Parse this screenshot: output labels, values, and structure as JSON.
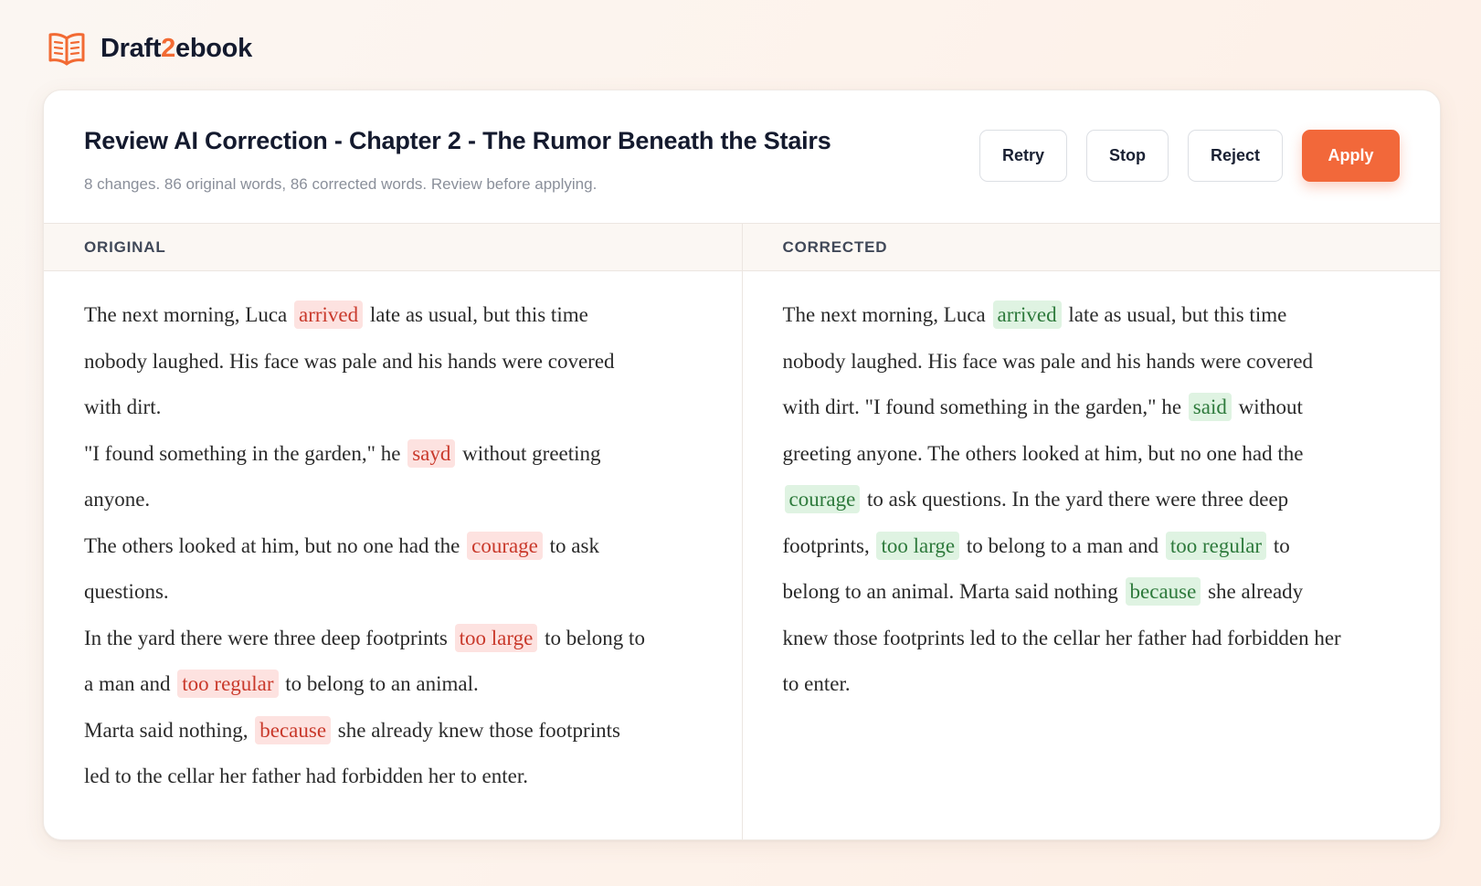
{
  "brand": {
    "name_prefix": "Draft",
    "name_accent": "2",
    "name_suffix": "ebook",
    "icon": "open-book-icon",
    "accent_color": "#f26a33"
  },
  "header": {
    "title": "Review AI Correction - Chapter 2 - The Rumor Beneath the Stairs",
    "subtitle": "8 changes. 86 original words, 86 corrected words. Review before applying."
  },
  "actions": {
    "retry": "Retry",
    "stop": "Stop",
    "reject": "Reject",
    "apply": "Apply",
    "apply_color": "#f2683a"
  },
  "original": {
    "label": "ORIGINAL",
    "highlight_color": "#c9392b",
    "paragraphs": [
      {
        "t1": "The next morning, Luca",
        "h1": "arrived",
        "t2": "late as usual, but this time nobody laughed. His face was pale and his hands were covered with dirt."
      },
      {
        "t1": "\"I found something in the garden,\" he",
        "h1": "sayd",
        "t2": "without greeting anyone."
      },
      {
        "t1": "The others looked at him, but no one had the",
        "h1": "courage",
        "t2": "to ask questions."
      },
      {
        "t1": "In the yard there were three deep footprints",
        "h1": "too large",
        "t2": "to belong to a man and",
        "h2": "too regular",
        "t3": "to belong to an animal."
      },
      {
        "t1": "Marta said nothing,",
        "h1": "because",
        "t2": "she already knew those footprints led to the cellar her father had forbidden her to enter."
      }
    ]
  },
  "corrected": {
    "label": "CORRECTED",
    "highlight_color": "#2e7a3c",
    "paragraph": {
      "t1": "The next morning, Luca",
      "h1": "arrived",
      "t2": "late as usual, but this time nobody laughed. His face was pale and his hands were covered with dirt. \"I found something in the garden,\" he",
      "h2": "said",
      "t3": "without greeting anyone. The others looked at him, but no one had the",
      "h3": "courage",
      "t4": "to ask questions. In the yard there were three deep footprints,",
      "h4": "too large",
      "t5": "to belong to a man and",
      "h5": "too regular",
      "t6": "to belong to an animal. Marta said nothing",
      "h6": "because",
      "t7": "she already knew those footprints led to the cellar her father had forbidden her to enter."
    }
  }
}
